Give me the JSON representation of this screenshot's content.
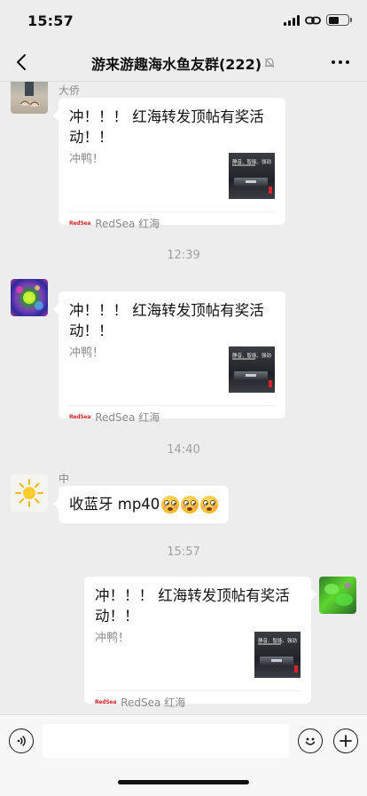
{
  "status_bar": {
    "time": "15:57"
  },
  "nav": {
    "title": "游来游趣海水鱼友群(222)",
    "muted": true
  },
  "messages": [
    {
      "sender": "大侨",
      "side": "left",
      "type": "link_card",
      "title": "冲！！！ 红海转发顶帖有奖活动！！",
      "desc": "冲鸭！",
      "thumb_text": "静音、智能、强劲",
      "source_logo": "RedSea",
      "source": "RedSea 红海"
    },
    {
      "type": "timestamp",
      "text": "12:39"
    },
    {
      "sender": "",
      "side": "left",
      "type": "link_card",
      "title": "冲！！！ 红海转发顶帖有奖活动！！",
      "desc": "冲鸭！",
      "thumb_text": "静音、智能、强劲",
      "source_logo": "RedSea",
      "source": "RedSea 红海"
    },
    {
      "type": "timestamp",
      "text": "14:40"
    },
    {
      "sender": "中",
      "side": "left",
      "type": "text",
      "text": "收蓝牙 mp40",
      "emoji": [
        "flushed-face-emoji",
        "flushed-face-emoji",
        "flushed-face-emoji"
      ]
    },
    {
      "type": "timestamp",
      "text": "15:57"
    },
    {
      "sender": "",
      "side": "right",
      "type": "link_card",
      "title": "冲！！！ 红海转发顶帖有奖活动！！",
      "desc": "冲鸭！",
      "thumb_text": "静音、智能、强劲",
      "source_logo": "RedSea",
      "source": "RedSea 红海"
    }
  ],
  "input_bar": {
    "value": "",
    "icons": [
      "voice-icon",
      "emoji-icon",
      "plus-icon"
    ]
  }
}
